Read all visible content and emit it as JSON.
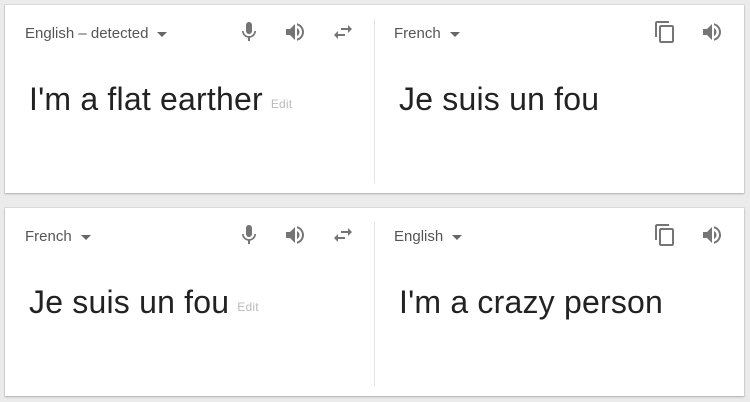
{
  "top": {
    "source_lang": "English – detected",
    "source_text": "I'm a flat earther",
    "edit_label": "Edit",
    "target_lang": "French",
    "target_text": "Je suis un fou"
  },
  "bottom": {
    "source_lang": "French",
    "source_text": "Je suis un fou",
    "edit_label": "Edit",
    "target_lang": "English",
    "target_text": "I'm a crazy person"
  },
  "icons": {
    "mic": "microphone-icon",
    "speaker": "speaker-icon",
    "swap": "swap-icon",
    "copy": "copy-icon"
  }
}
